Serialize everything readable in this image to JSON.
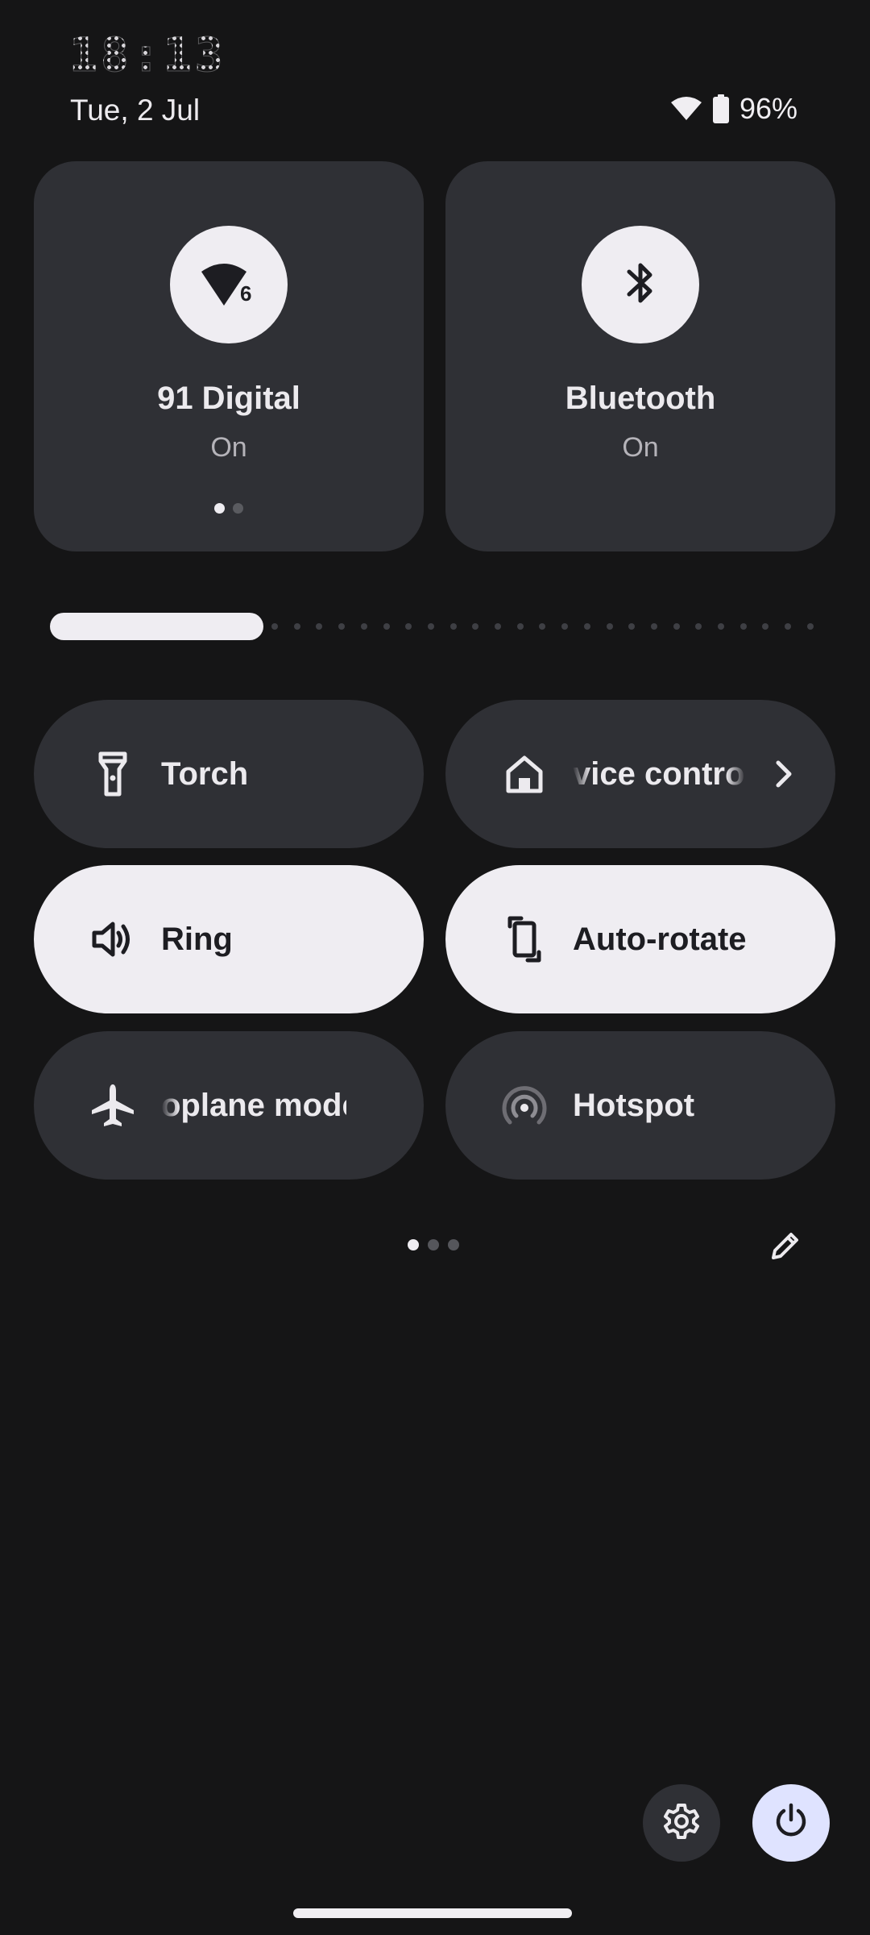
{
  "status": {
    "time": "18:13",
    "date": "Tue, 2 Jul",
    "battery": "96%",
    "wifi_icon": "wifi-icon",
    "battery_icon": "battery-icon"
  },
  "big_tiles": [
    {
      "title": "91 Digital",
      "state": "On",
      "icon": "wifi-6-icon",
      "page_count": 2,
      "active_page": 1
    },
    {
      "title": "Bluetooth",
      "state": "On",
      "icon": "bluetooth-icon"
    }
  ],
  "brightness": {
    "level": 0.28
  },
  "tiles": {
    "torch": {
      "label": "Torch",
      "icon": "flashlight-icon",
      "active": false
    },
    "device_controls": {
      "label": "vice control",
      "icon": "home-icon",
      "active": false
    },
    "ring": {
      "label": "Ring",
      "icon": "volume-icon",
      "active": true
    },
    "auto_rotate": {
      "label": "Auto-rotate",
      "icon": "rotate-icon",
      "active": true
    },
    "airplane": {
      "label": "oplane mode",
      "icon": "airplane-icon",
      "active": false
    },
    "hotspot": {
      "label": "Hotspot",
      "icon": "hotspot-icon",
      "active": false
    }
  },
  "pager": {
    "count": 3,
    "active": 1
  },
  "colors": {
    "background": "#151516",
    "tile": "#2f3035",
    "tile_active": "#efedf2",
    "power_button": "#dfe3ff"
  }
}
